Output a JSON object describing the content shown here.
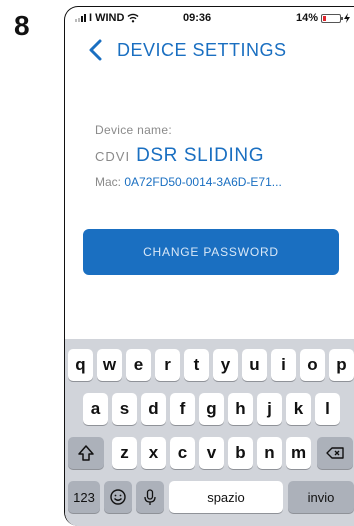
{
  "step": "8",
  "status_bar": {
    "carrier": "I WIND",
    "time": "09:36",
    "battery": "14%"
  },
  "nav": {
    "title": "DEVICE SETTINGS"
  },
  "device": {
    "name_label": "Device name:",
    "brand": "CDVI",
    "name": "DSR SLIDING",
    "mac_label": "Mac:",
    "mac_value": "0A72FD50-0014-3A6D-E71..."
  },
  "change_password_label": "CHANGE PASSWORD",
  "keyboard": {
    "row1": [
      "q",
      "w",
      "e",
      "r",
      "t",
      "y",
      "u",
      "i",
      "o",
      "p"
    ],
    "row2": [
      "a",
      "s",
      "d",
      "f",
      "g",
      "h",
      "j",
      "k",
      "l"
    ],
    "row3": [
      "z",
      "x",
      "c",
      "v",
      "b",
      "n",
      "m"
    ],
    "numbers_key": "123",
    "space_key": "spazio",
    "return_key": "invio"
  },
  "colors": {
    "accent": "#1a6fc1",
    "battery_low": "#e0262d"
  }
}
